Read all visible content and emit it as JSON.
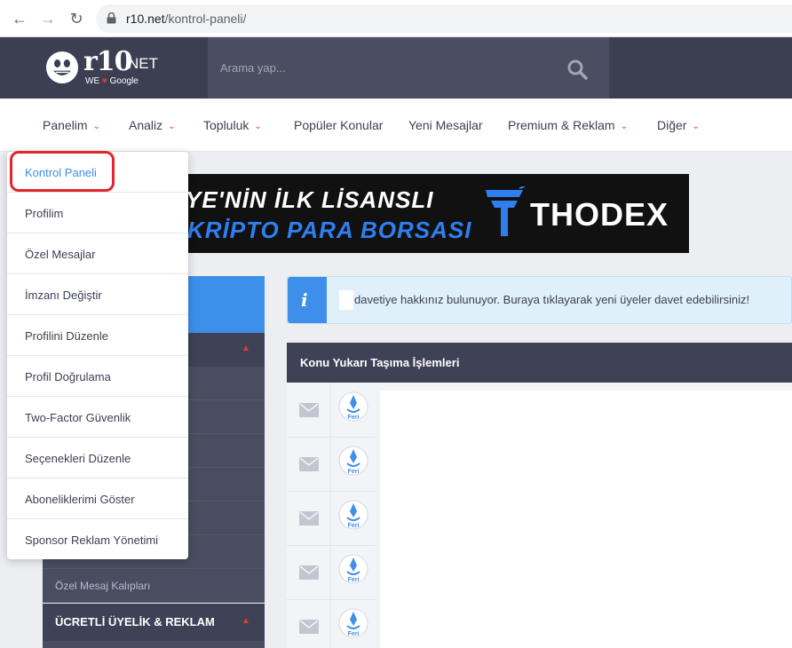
{
  "browser": {
    "url_domain": "r10.net",
    "url_path": "/kontrol-paneli/"
  },
  "header": {
    "logo_main": "r10",
    "logo_suffix": "NET",
    "logo_tag_we": "WE",
    "logo_tag_google": "Google",
    "search_placeholder": "Arama yap..."
  },
  "nav": {
    "items": [
      {
        "label": "Panelim",
        "has_dropdown": true
      },
      {
        "label": "Analiz",
        "has_dropdown": true
      },
      {
        "label": "Topluluk",
        "has_dropdown": true
      },
      {
        "label": "Popüler Konular",
        "has_dropdown": false
      },
      {
        "label": "Yeni Mesajlar",
        "has_dropdown": false
      },
      {
        "label": "Premium & Reklam",
        "has_dropdown": true
      },
      {
        "label": "Diğer",
        "has_dropdown": true
      }
    ]
  },
  "banner": {
    "line1": "YE'NİN İLK LİSANSLI",
    "line2": "KRİPTO PARA BORSASI",
    "brand": "THODEX"
  },
  "dropdown": {
    "items": [
      "Kontrol Paneli",
      "Profilim",
      "Özel Mesajlar",
      "İmzanı Değiştir",
      "Profilini Düzenle",
      "Profil Doğrulama",
      "Two-Factor Güvenlik",
      "Seçenekleri Düzenle",
      "Aboneliklerimi Göster",
      "Sponsor Reklam Yönetimi"
    ],
    "active_index": 0
  },
  "sidebar": {
    "sub_items": [
      "Özel Mesaj Kalıpları"
    ],
    "paid_section": "ÜCRETLİ ÜYELİK & REKLAM"
  },
  "alert": {
    "text": "davetiye hakkınız bulunuyor. Buraya tıklayarak yeni üyeler davet edebilirsiniz!"
  },
  "panel": {
    "title": "Konu Yukarı Taşıma İşlemleri",
    "avatar_label": "Feri",
    "row_count": 5
  },
  "colors": {
    "header_bg": "#3c3f52",
    "accent_blue": "#3d8fea",
    "accent_red": "#e53935"
  }
}
